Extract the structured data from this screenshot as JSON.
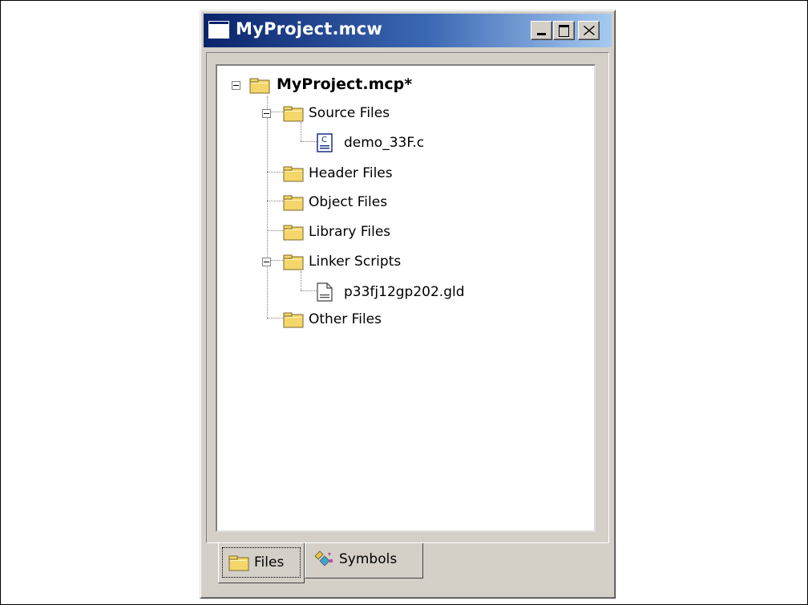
{
  "window": {
    "title": "MyProject.mcw",
    "controls": {
      "minimize": "minimize-icon",
      "maximize": "maximize-icon",
      "close": "close-icon"
    }
  },
  "tree": {
    "root": {
      "label": "MyProject.mcp*",
      "icon": "folder-icon"
    },
    "items": [
      {
        "label": "Source Files",
        "icon": "folder-icon"
      },
      {
        "label": "demo_33F.c",
        "icon": "c-source-file-icon"
      },
      {
        "label": "Header Files",
        "icon": "folder-icon"
      },
      {
        "label": "Object Files",
        "icon": "folder-icon"
      },
      {
        "label": "Library Files",
        "icon": "folder-icon"
      },
      {
        "label": "Linker Scripts",
        "icon": "folder-icon"
      },
      {
        "label": "p33fj12gp202.gld",
        "icon": "document-file-icon"
      },
      {
        "label": "Other Files",
        "icon": "folder-icon"
      }
    ]
  },
  "tabs": [
    {
      "label": "Files",
      "icon": "folder-icon",
      "active": true
    },
    {
      "label": "Symbols",
      "icon": "symbols-icon",
      "active": false
    }
  ],
  "colors": {
    "titlebar_start": "#0a246a",
    "titlebar_end": "#a6caf0",
    "chrome": "#d4d0c8",
    "folder": "#f5d66b"
  }
}
